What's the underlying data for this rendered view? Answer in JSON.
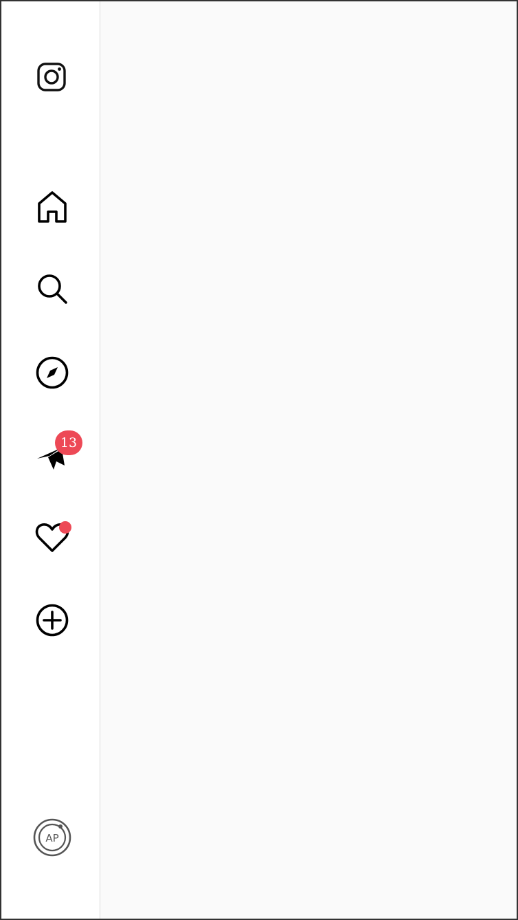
{
  "sidebar": {
    "logo": {
      "icon": "instagram-logo-icon"
    },
    "items": [
      {
        "id": "home",
        "icon": "home-icon"
      },
      {
        "id": "search",
        "icon": "search-icon"
      },
      {
        "id": "explore",
        "icon": "compass-icon"
      },
      {
        "id": "direct",
        "icon": "paper-plane-icon",
        "badge": "13"
      },
      {
        "id": "notifications",
        "icon": "heart-icon",
        "has_dot": true
      },
      {
        "id": "create",
        "icon": "plus-circle-icon"
      }
    ],
    "profile": {
      "icon": "avatar-icon",
      "initials": "AP"
    }
  },
  "colors": {
    "badge": "#ed4956",
    "icon": "#000000",
    "sidebar_bg": "#ffffff",
    "main_bg": "#fafafa"
  }
}
